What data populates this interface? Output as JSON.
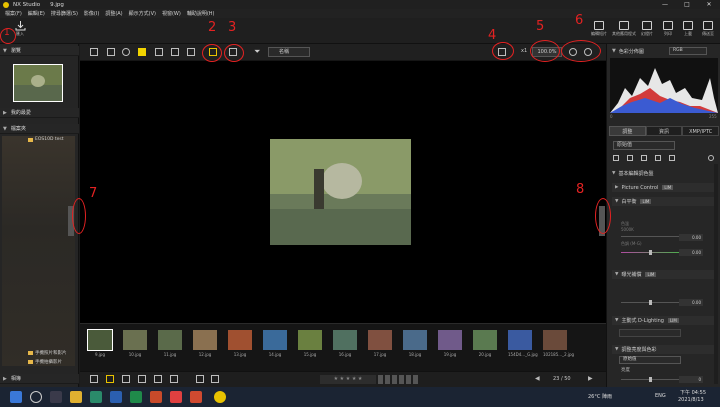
{
  "window": {
    "app_name": "NX Studio",
    "file_name": "9.jpg",
    "controls": [
      "—",
      "□",
      "✕"
    ]
  },
  "menu": [
    "檔案(F)",
    "編輯(E)",
    "搜尋篩選(S)",
    "影像(I)",
    "調整(A)",
    "顯示方式(V)",
    "視窗(W)",
    "輔助說明(H)"
  ],
  "toolbar": {
    "import_label": "匯入",
    "right_buttons": [
      "編輯短片",
      "其他應用程式",
      "幻燈片",
      "列印",
      "上載",
      "傳送至"
    ]
  },
  "left_panel": {
    "sections": [
      "瀏覽",
      "我的最愛",
      "檔案夾",
      "相簿"
    ],
    "folders": [
      "EOS10D test",
      "手機照片和影片",
      "手機拍攝影片"
    ]
  },
  "view_toolbar": {
    "sort_label": "名稱",
    "zoom_badge": "x1",
    "zoom_value": "100.0%"
  },
  "filmstrip": {
    "thumbnails": [
      {
        "caption": "9.jpg",
        "color": "#4a5a3a",
        "selected": true
      },
      {
        "caption": "10.jpg",
        "color": "#6a7050"
      },
      {
        "caption": "11.jpg",
        "color": "#5a6a4a"
      },
      {
        "caption": "12.jpg",
        "color": "#8a7050"
      },
      {
        "caption": "13.jpg",
        "color": "#a05030"
      },
      {
        "caption": "14.jpg",
        "color": "#3a6a9a"
      },
      {
        "caption": "15.jpg",
        "color": "#6a8040"
      },
      {
        "caption": "16.jpg",
        "color": "#507060"
      },
      {
        "caption": "17.jpg",
        "color": "#805040"
      },
      {
        "caption": "18.jpg",
        "color": "#4a6a8a"
      },
      {
        "caption": "19.jpg",
        "color": "#705a8a"
      },
      {
        "caption": "20.jpg",
        "color": "#5a7a50"
      },
      {
        "caption": "154D4..._G.jpg",
        "color": "#3a5aa0"
      },
      {
        "caption": "102185..._2.jpg",
        "color": "#6a4a3a"
      }
    ]
  },
  "bottom_bar": {
    "page_counter": "23 / 50"
  },
  "right_panel": {
    "histogram_title": "色彩分佈圖",
    "histogram_mode": "RGB",
    "hist_min": "0",
    "hist_max": "255",
    "tabs": [
      "調整",
      "資訊",
      "XMP/IPTC"
    ],
    "preset": "原始值",
    "sections": [
      {
        "title": "基本編輯調色盤"
      },
      {
        "title": "Picture Control",
        "badge": "LIM"
      },
      {
        "title": "白平衡",
        "badge": "LIM"
      },
      {
        "title": "曝光補償",
        "badge": "LIM"
      },
      {
        "title": "主動式 D-Lighting",
        "badge": "LIM"
      },
      {
        "title": "調整亮度與色彩"
      }
    ],
    "wb_labels": [
      "色溫",
      "5000K",
      "色調 (M-G)",
      "0.00"
    ],
    "bright_label": "亮度",
    "bright_preset": "原始值",
    "slider_values": [
      "0.00",
      "0.00",
      "0"
    ]
  },
  "annotations": [
    "1",
    "2",
    "3",
    "4",
    "5",
    "6",
    "7",
    "8"
  ],
  "taskbar": {
    "weather": "26°C 陣雨",
    "lang": "ENG",
    "time": "下午 04:55",
    "date": "2021/8/13"
  }
}
